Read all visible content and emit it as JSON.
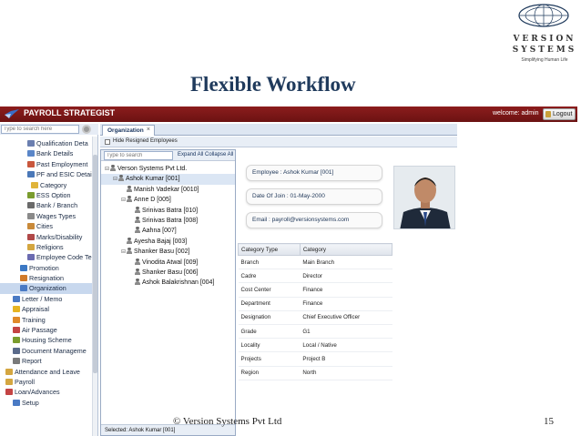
{
  "slide": {
    "title": "Flexible Workflow",
    "footer": "© Version Systems Pvt Ltd",
    "page_number": "15"
  },
  "logo": {
    "brand_line1": "VERSION",
    "brand_line2": "SYSTEMS",
    "tagline": "Simplifying Human Life"
  },
  "app": {
    "name": "PAYROLL STRATEGIST",
    "welcome": "welcome: admin",
    "logout_label": "Logout"
  },
  "sidebar": {
    "search_placeholder": "Type to search here",
    "items": [
      {
        "label": "Qualification Deta",
        "icon": "document-icon",
        "color": "#6b7fb0",
        "indent": 30
      },
      {
        "label": "Bank Details",
        "icon": "document-icon",
        "color": "#5a86c8",
        "indent": 30
      },
      {
        "label": "Past Employment",
        "icon": "document-icon",
        "color": "#c9573d",
        "indent": 30
      },
      {
        "label": "PF and ESIC Detail",
        "icon": "chart-icon",
        "color": "#4a78b8",
        "indent": 30
      },
      {
        "label": "Category",
        "icon": "folder-icon",
        "color": "#e0b43a",
        "indent": 34
      },
      {
        "label": "ESS Option",
        "icon": "option-icon",
        "color": "#7a9c2e",
        "indent": 30
      },
      {
        "label": "Bank / Branch",
        "icon": "bank-icon",
        "color": "#6a6a6a",
        "indent": 30
      },
      {
        "label": "Wages Types",
        "icon": "document-icon",
        "color": "#8a8a8a",
        "indent": 30
      },
      {
        "label": "Cities",
        "icon": "city-icon",
        "color": "#c98a3a",
        "indent": 30
      },
      {
        "label": "Marks/Disability",
        "icon": "person-icon",
        "color": "#b04848",
        "indent": 30
      },
      {
        "label": "Religions",
        "icon": "religion-icon",
        "color": "#d4a640",
        "indent": 30
      },
      {
        "label": "Employee Code Te",
        "icon": "code-icon",
        "color": "#6b6bb0",
        "indent": 30
      },
      {
        "label": "Promotion",
        "icon": "promotion-icon",
        "color": "#3c78c4",
        "indent": 22
      },
      {
        "label": "Resignation",
        "icon": "resignation-icon",
        "color": "#d07a2a",
        "indent": 22
      },
      {
        "label": "Organization",
        "icon": "organization-icon",
        "color": "#4a7ac4",
        "indent": 22,
        "selected": true
      },
      {
        "label": "Letter / Memo",
        "icon": "letter-icon",
        "color": "#4a7ac4",
        "indent": 14
      },
      {
        "label": "Appraisal",
        "icon": "star-icon",
        "color": "#e6b422",
        "indent": 14
      },
      {
        "label": "Training",
        "icon": "training-icon",
        "color": "#e08a2a",
        "indent": 14
      },
      {
        "label": "Air Passage",
        "icon": "car-icon",
        "color": "#c44444",
        "indent": 14
      },
      {
        "label": "Housing Scheme",
        "icon": "house-icon",
        "color": "#7a9c2e",
        "indent": 14
      },
      {
        "label": "Document Manageme",
        "icon": "document-icon",
        "color": "#5a6a8a",
        "indent": 14
      },
      {
        "label": "Report",
        "icon": "report-icon",
        "color": "#7a7a7a",
        "indent": 14
      },
      {
        "label": "Attendance and Leave",
        "icon": "attendance-icon",
        "color": "#d4a640",
        "indent": 6
      },
      {
        "label": "Payroll",
        "icon": "payroll-icon",
        "color": "#d4a640",
        "indent": 6
      },
      {
        "label": "Loan/Advances",
        "icon": "loan-icon",
        "color": "#c44444",
        "indent": 6
      },
      {
        "label": "Setup",
        "icon": "setup-icon",
        "color": "#4a7ac4",
        "indent": 14
      }
    ]
  },
  "main": {
    "tab_label": "Organization",
    "hide_resigned_label": "Hide Resigned Employees",
    "tree": {
      "search_placeholder": "Type to search",
      "expand_all": "Expand All",
      "collapse_all": "Collapse All",
      "nodes": [
        {
          "label": "Verson Systems Pvt Ltd.",
          "level": 0,
          "expander": "⊟",
          "type": "company"
        },
        {
          "label": "Ashok Kumar [001]",
          "level": 1,
          "expander": "⊟",
          "type": "person",
          "selected": true
        },
        {
          "label": "Manish Vadekar [0010]",
          "level": 2,
          "expander": "",
          "type": "person"
        },
        {
          "label": "Anne D [005]",
          "level": 2,
          "expander": "⊟",
          "type": "person"
        },
        {
          "label": "Srinivas Batra [010]",
          "level": 3,
          "expander": "",
          "type": "person"
        },
        {
          "label": "Srinivas Batra [008]",
          "level": 3,
          "expander": "",
          "type": "person"
        },
        {
          "label": "Aahna [007]",
          "level": 3,
          "expander": "",
          "type": "person"
        },
        {
          "label": "Ayesha Bajaj [003]",
          "level": 2,
          "expander": "",
          "type": "person"
        },
        {
          "label": "Shanker Basu [002]",
          "level": 2,
          "expander": "⊟",
          "type": "person"
        },
        {
          "label": "Vinodita Atwal [009]",
          "level": 3,
          "expander": "",
          "type": "person"
        },
        {
          "label": "Shanker Basu [006]",
          "level": 3,
          "expander": "",
          "type": "person"
        },
        {
          "label": "Ashok Balakrishnan [004]",
          "level": 3,
          "expander": "",
          "type": "person"
        }
      ],
      "selected_footer": "Selected: Ashok Kumar [001]"
    },
    "details": {
      "employee": "Employee : Ashok Kumar [001]",
      "doj": "Date Of Join : 01-May-2000",
      "email": "Email : payroll@versionsystems.com",
      "table_headers": [
        "Category Type",
        "Category"
      ],
      "rows": [
        [
          "Branch",
          "Main Branch"
        ],
        [
          "Cadre",
          "Director"
        ],
        [
          "Cost Center",
          "Finance"
        ],
        [
          "Department",
          "Finance"
        ],
        [
          "Designation",
          "Chief Executive Officer"
        ],
        [
          "Grade",
          "G1"
        ],
        [
          "Locality",
          "Local / Native"
        ],
        [
          "Projects",
          "Project B"
        ],
        [
          "Region",
          "North"
        ]
      ]
    }
  }
}
